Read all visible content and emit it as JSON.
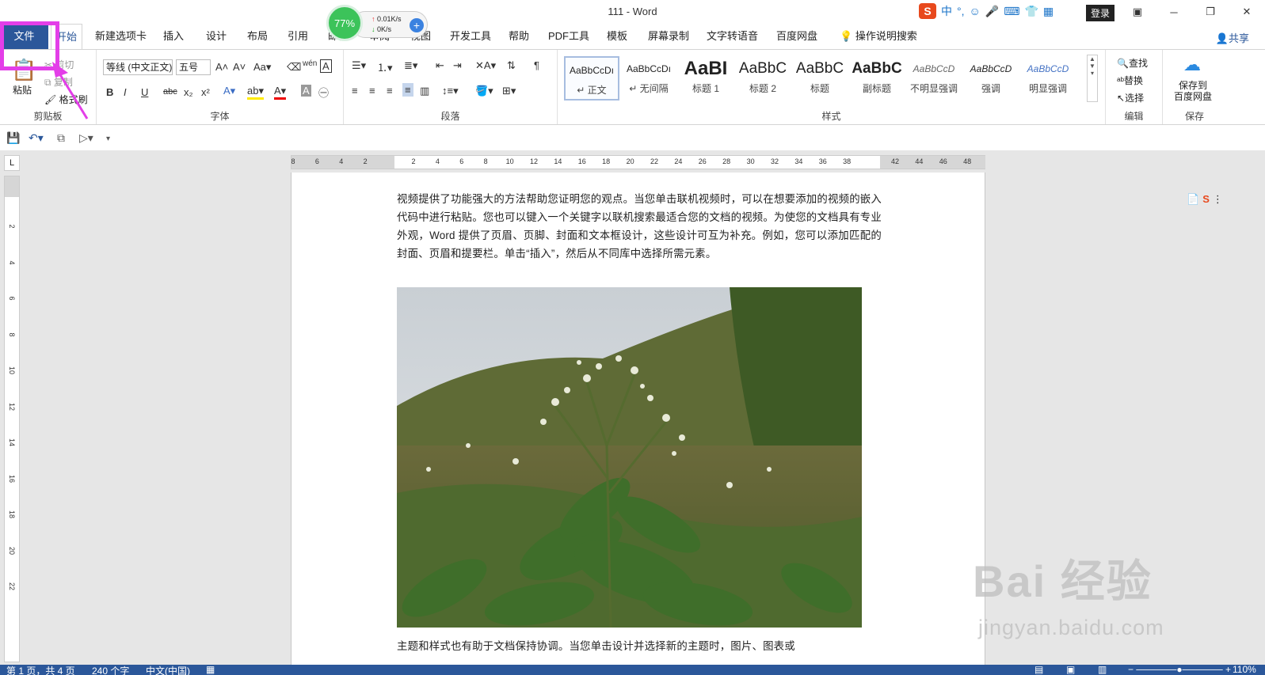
{
  "window": {
    "title": "111  -  Word",
    "login": "登录",
    "ime": [
      "中",
      "°,",
      "☺",
      "🎤",
      "⌨",
      "👕",
      "▦"
    ]
  },
  "netmon": {
    "percent": "77%",
    "up": "0.01K/s",
    "down": "0K/s"
  },
  "tabs": [
    "文件",
    "开始",
    "新建选项卡",
    "插入",
    "设计",
    "布局",
    "引用",
    "邮件",
    "审阅",
    "视图",
    "开发工具",
    "帮助",
    "PDF工具",
    "模板",
    "屏幕录制",
    "文字转语音",
    "百度网盘",
    "操作说明搜索"
  ],
  "share": "共享",
  "clipboard": {
    "paste": "粘贴",
    "cut": "剪切",
    "copy": "复制",
    "format_painter": "格式刷",
    "label": "剪贴板"
  },
  "font": {
    "name": "等线 (中文正文)",
    "size": "五号",
    "label": "字体",
    "bold": "B",
    "italic": "I",
    "underline": "U",
    "strike": "abc",
    "sub": "x₂",
    "sup": "x²"
  },
  "paragraph": {
    "label": "段落"
  },
  "styles": {
    "label": "样式",
    "items": [
      {
        "preview": "AaBbCcDı",
        "name": "↵ 正文"
      },
      {
        "preview": "AaBbCcDı",
        "name": "↵ 无间隔"
      },
      {
        "preview": "AaBI",
        "name": "标题 1"
      },
      {
        "preview": "AaBbC",
        "name": "标题 2"
      },
      {
        "preview": "AaBbC",
        "name": "标题"
      },
      {
        "preview": "AaBbC",
        "name": "副标题"
      },
      {
        "preview": "AaBbCcD",
        "name": "不明显强调"
      },
      {
        "preview": "AaBbCcD",
        "name": "强调"
      },
      {
        "preview": "AaBbCcD",
        "name": "明显强调"
      }
    ]
  },
  "editing": {
    "find": "查找",
    "replace": "替换",
    "select": "选择",
    "label": "编辑"
  },
  "save": {
    "line1": "保存到",
    "line2": "百度网盘",
    "label": "保存"
  },
  "ruler": {
    "h_ticks": [
      "8",
      "6",
      "4",
      "2",
      "",
      "2",
      "4",
      "6",
      "8",
      "10",
      "12",
      "14",
      "16",
      "18",
      "20",
      "22",
      "24",
      "26",
      "28",
      "30",
      "32",
      "34",
      "36",
      "38",
      "",
      "42",
      "44",
      "46",
      "48"
    ],
    "v_ticks": [
      "2",
      "4",
      "6",
      "8",
      "10",
      "12",
      "14",
      "16",
      "18",
      "20",
      "22"
    ]
  },
  "document": {
    "para1": "视频提供了功能强大的方法帮助您证明您的观点。当您单击联机视频时，可以在想要添加的视频的嵌入代码中进行粘贴。您也可以键入一个关键字以联机搜索最适合您的文档的视频。为使您的文档具有专业外观，Word 提供了页眉、页脚、封面和文本框设计，这些设计可互为补充。例如，您可以添加匹配的封面、页眉和提要栏。单击“插入”，然后从不同库中选择所需元素。",
    "para2": "主题和样式也有助于文档保持协调。当您单击设计并选择新的主题时，图片、图表或"
  },
  "status": {
    "page": "第 1 页，共 4 页",
    "words": "240 个字",
    "lang": "中文(中国)",
    "zoom": "110%"
  },
  "watermark": {
    "main": "Bai 经验",
    "sub": "jingyan.baidu.com"
  },
  "colors": {
    "accent": "#2b579a",
    "highlight": "#e33ee8"
  }
}
